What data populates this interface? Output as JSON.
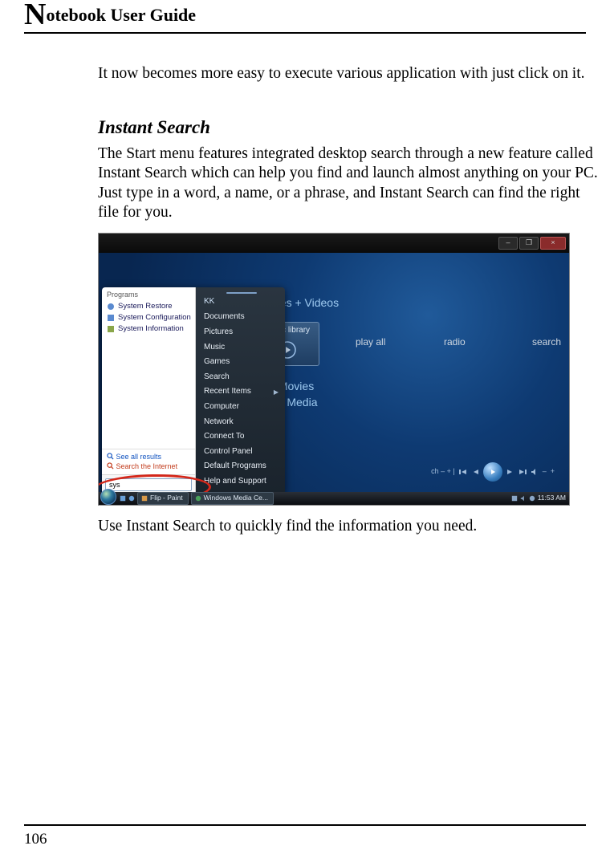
{
  "header": {
    "title_rest": "otebook User Guide",
    "dropcap": "N"
  },
  "intro": "It now becomes more easy to execute various application with just click on it.",
  "section_heading": "Instant Search",
  "section_para": "The Start menu features integrated desktop search through a new feature called Instant Search which can help you find and launch almost anything on your PC. Just type in a word, a name, or a phrase, and Instant Search can find the right file for you.",
  "caption": "Use Instant Search to quickly find the information you need.",
  "page_number": "106",
  "screenshot": {
    "window_buttons": {
      "minimize": "–",
      "maximize": "❐",
      "close": "×"
    },
    "media_center": {
      "pictures_videos": "Pictures + Videos",
      "music": "Music",
      "music_library": "music library",
      "play_all": "play all",
      "radio": "radio",
      "search": "search",
      "tv_movies": "TV + Movies",
      "online_media": "Online Media",
      "ctrlbar_text": "ch  –  +  |"
    },
    "start_menu": {
      "programs_header": "Programs",
      "programs": [
        "System Restore",
        "System Configuration",
        "System Information"
      ],
      "see_all": "See all results",
      "search_internet": "Search the Internet",
      "search_value": "sys",
      "username": "KK",
      "right_items": [
        "Documents",
        "Pictures",
        "Music",
        "Games",
        "Search",
        "Recent Items",
        "Computer",
        "Network",
        "Connect To",
        "Control Panel",
        "Default Programs",
        "Help and Support"
      ]
    },
    "taskbar": {
      "task1": "Flip - Paint",
      "task2": "Windows Media Ce...",
      "clock": "11:53 AM"
    }
  }
}
